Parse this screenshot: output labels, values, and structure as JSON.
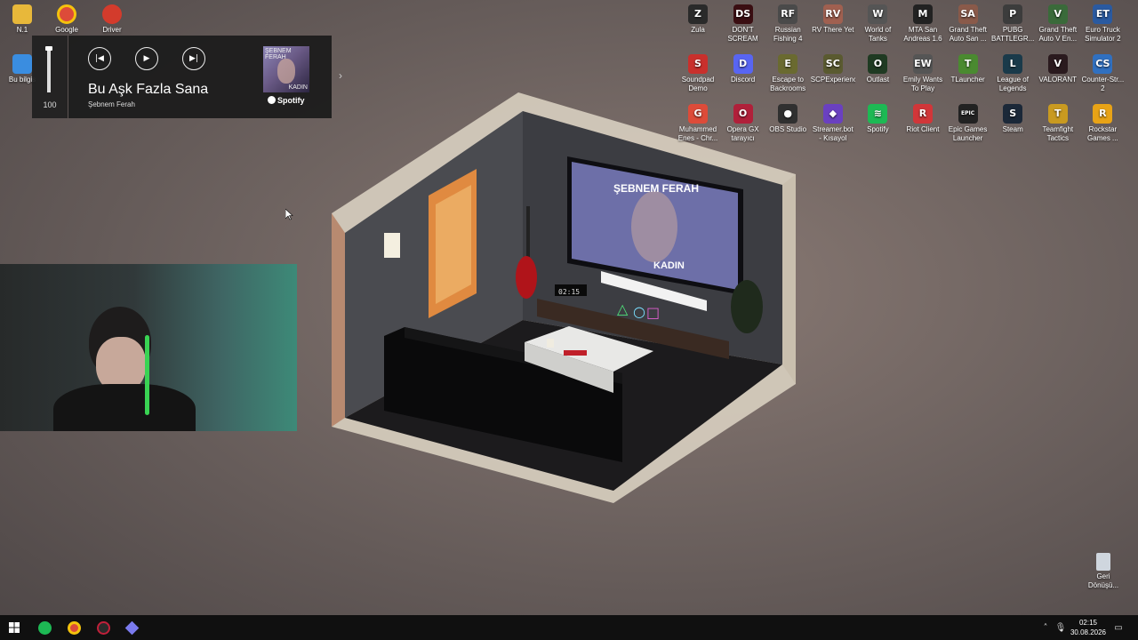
{
  "desktop": {
    "left_icons": [
      {
        "label": "N.1",
        "icon": "folder-icon",
        "color": "#e8b83a"
      },
      {
        "label": "Google",
        "icon": "chrome-icon",
        "color": "#dd4b39"
      },
      {
        "label": "Driver",
        "icon": "driver-icon",
        "color": "#d33b2c"
      },
      {
        "label": "Bu bilgis",
        "icon": "computer-icon",
        "color": "#3a8de0"
      }
    ],
    "right_icons": [
      {
        "label": "Zula",
        "icon": "zula-icon",
        "color": "#2a2a2a",
        "glyph": "Z"
      },
      {
        "label": "DON'T SCREAM",
        "icon": "dont-scream-icon",
        "color": "#3a0e12",
        "glyph": "DS"
      },
      {
        "label": "Russian Fishing 4",
        "icon": "fishing-icon",
        "color": "#4a4a4a",
        "glyph": "RF"
      },
      {
        "label": "RV There Yet",
        "icon": "rv-icon",
        "color": "#a06050",
        "glyph": "RV"
      },
      {
        "label": "World of Tanks",
        "icon": "tanks-icon",
        "color": "#555",
        "glyph": "W"
      },
      {
        "label": "MTA San Andreas 1.6",
        "icon": "mta-icon",
        "color": "#222",
        "glyph": "M"
      },
      {
        "label": "Grand Theft Auto San ...",
        "icon": "gta-sa-icon",
        "color": "#8a5a4a",
        "glyph": "SA"
      },
      {
        "label": "PUBG BATTLEGR...",
        "icon": "pubg-icon",
        "color": "#3c3c3c",
        "glyph": "P"
      },
      {
        "label": "Grand Theft Auto V En...",
        "icon": "gta-v-icon",
        "color": "#3a6a3a",
        "glyph": "V"
      },
      {
        "label": "Euro Truck Simulator 2",
        "icon": "truck-icon",
        "color": "#2a5aa0",
        "glyph": "ET"
      },
      {
        "label": "Soundpad Demo",
        "icon": "soundpad-icon",
        "color": "#c9302c",
        "glyph": "S"
      },
      {
        "label": "Discord",
        "icon": "discord-icon",
        "color": "#5865f2",
        "glyph": "D"
      },
      {
        "label": "Escape to Backrooms",
        "icon": "backrooms-icon",
        "color": "#6a6a30",
        "glyph": "E"
      },
      {
        "label": "SCPExperienc",
        "icon": "scp-icon",
        "color": "#5a5a30",
        "glyph": "SC"
      },
      {
        "label": "Outlast",
        "icon": "outlast-icon",
        "color": "#1f3a22",
        "glyph": "O"
      },
      {
        "label": "Emily Wants To Play",
        "icon": "emily-icon",
        "color": "#555",
        "glyph": "EW"
      },
      {
        "label": "TLauncher",
        "icon": "tlauncher-icon",
        "color": "#4a8a30",
        "glyph": "T"
      },
      {
        "label": "League of Legends",
        "icon": "lol-icon",
        "color": "#1a3a4a",
        "glyph": "L"
      },
      {
        "label": "VALORANT",
        "icon": "valorant-icon",
        "color": "#2a1a1e",
        "glyph": "V"
      },
      {
        "label": "Counter-Str... 2",
        "icon": "cs2-icon",
        "color": "#3070c0",
        "glyph": "CS"
      },
      {
        "label": "Muhammed Enes - Chr...",
        "icon": "chrome-profile-icon",
        "color": "#dd4b39",
        "glyph": "G"
      },
      {
        "label": "Opera GX tarayıcı",
        "icon": "opera-gx-icon",
        "color": "#b0203a",
        "glyph": "O"
      },
      {
        "label": "OBS Studio",
        "icon": "obs-icon",
        "color": "#303030",
        "glyph": "●"
      },
      {
        "label": "Streamer.bot - Kısayol",
        "icon": "streamerbot-icon",
        "color": "#6a40c0",
        "glyph": "◆"
      },
      {
        "label": "Spotify",
        "icon": "spotify-icon",
        "color": "#1db954",
        "glyph": "≋"
      },
      {
        "label": "Riot Client",
        "icon": "riot-icon",
        "color": "#d13639",
        "glyph": "R"
      },
      {
        "label": "Epic Games Launcher",
        "icon": "epic-icon",
        "color": "#222",
        "glyph": "EPIC"
      },
      {
        "label": "Steam",
        "icon": "steam-icon",
        "color": "#1b2838",
        "glyph": "S"
      },
      {
        "label": "Teamfight Tactics",
        "icon": "tft-icon",
        "color": "#c99a20",
        "glyph": "T"
      },
      {
        "label": "Rockstar Games ...",
        "icon": "rockstar-icon",
        "color": "#e8a316",
        "glyph": "R"
      }
    ],
    "recycle_bin": {
      "label": "Geri Dönüşü...",
      "icon": "recycle-bin-icon"
    }
  },
  "media": {
    "volume": 100,
    "volume_text": "100",
    "title": "Bu Aşk Fazla Sana",
    "artist": "Şebnem Ferah",
    "source": "Spotify",
    "album_artist_text": "ŞEBNEM FERAH",
    "album_title_text": "KADIN",
    "prev_icon": "previous-track-icon",
    "play_icon": "play-icon",
    "next_icon": "next-track-icon"
  },
  "wallpaper": {
    "tv_artist": "ŞEBNEM FERAH",
    "tv_title": "KADIN",
    "clock": "02:15"
  },
  "taskbar": {
    "pinned": [
      {
        "name": "start-button",
        "color": "#3a8de0"
      },
      {
        "name": "spotify",
        "color": "#1db954"
      },
      {
        "name": "chrome",
        "color": "#dd4b39"
      },
      {
        "name": "opera-gx",
        "color": "#c0203a"
      },
      {
        "name": "streamerbot",
        "color": "#6a6ae0"
      }
    ],
    "time": "02:15",
    "date": "30.08.2026"
  }
}
